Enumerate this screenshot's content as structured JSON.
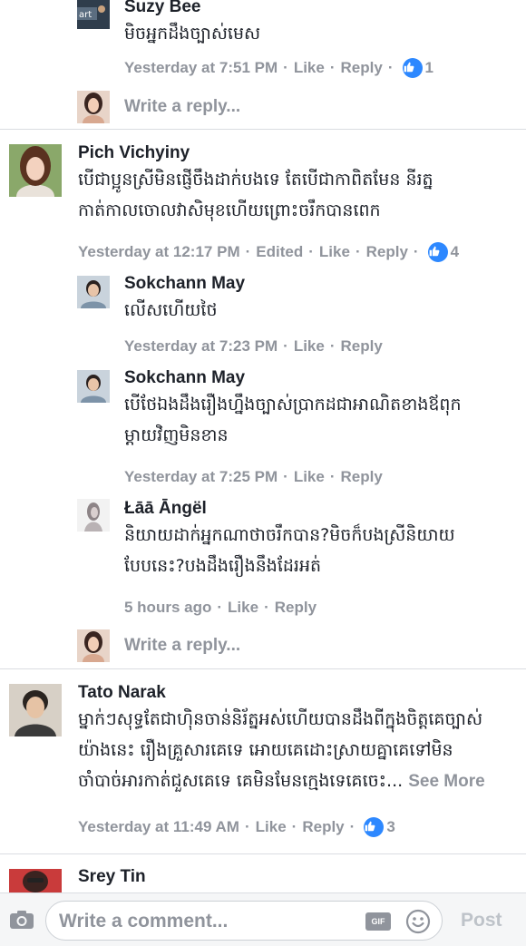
{
  "comments": [
    {
      "name": "Suzy Bee",
      "text_lines": [
        "មិចអ្នកដឹងច្បាស់មេស"
      ],
      "meta": {
        "time": "Yesterday at 7:51 PM",
        "like": "Like",
        "reply": "Reply",
        "likes": "1"
      }
    },
    {
      "write_reply": "Write a reply..."
    },
    {
      "name": "Pich Vichyiny",
      "text_lines": [
        "បើជាប្អូនស្រីមិនផ្ញើចឹងដាក់បងទេ តែបើជាកាពិតមែន នីរត្ន",
        "កាត់កាលចោលវាសិមុខហើយព្រោះចរឹកបានពេក"
      ],
      "meta": {
        "time": "Yesterday at 12:17 PM",
        "edited": "Edited",
        "like": "Like",
        "reply": "Reply",
        "likes": "4"
      }
    },
    {
      "name": "Sokchann May",
      "text_lines": [
        "លើសហើយថៃ"
      ],
      "meta": {
        "time": "Yesterday at 7:23 PM",
        "like": "Like",
        "reply": "Reply"
      }
    },
    {
      "name": "Sokchann May",
      "text_lines": [
        "បើថែឯងដឹងរឿងហ្នឹងច្បាស់ប្រាកដជាអាណិតខាងឪពុក",
        "ម្ដាយវិញមិនខាន"
      ],
      "meta": {
        "time": "Yesterday at 7:25 PM",
        "like": "Like",
        "reply": "Reply"
      }
    },
    {
      "name": "Łāā Āngël",
      "text_lines": [
        "និយាយដាក់អ្នកណាថាចរឹកបាន?មិចក៏បងស្រីនិយាយ",
        "បែបនេះ?បងដឹងរឿងនឹងដែរអត់"
      ],
      "meta": {
        "time": "5 hours ago",
        "like": "Like",
        "reply": "Reply"
      }
    },
    {
      "write_reply": "Write a reply..."
    },
    {
      "name": "Tato Narak",
      "text_lines": [
        "ម្នាក់ៗសុទ្ធតែជាហ៊ិនចាន់និរ័ត្នអស់ហើយបានដឹងពីក្នុងចិត្តគេច្បាស់",
        "យ៉ាងនេះ  រឿងគ្រួសារគេទេ អោយគេដោះស្រាយគ្នាគេទៅមិន",
        "ចាំបាច់អារកាត់ជួសគេទេ គេមិនមែនក្មេងទេគេចេះ..."
      ],
      "see_more": "See More",
      "meta": {
        "time": "Yesterday at 11:49 AM",
        "like": "Like",
        "reply": "Reply",
        "likes": "3"
      }
    },
    {
      "name": "Srey Tin"
    }
  ],
  "composer": {
    "placeholder": "Write a comment...",
    "gif": "GIF",
    "post": "Post"
  },
  "colors": {
    "like_blue": "#2d88ff",
    "meta_gray": "#90949c",
    "divider": "#dadde1"
  }
}
